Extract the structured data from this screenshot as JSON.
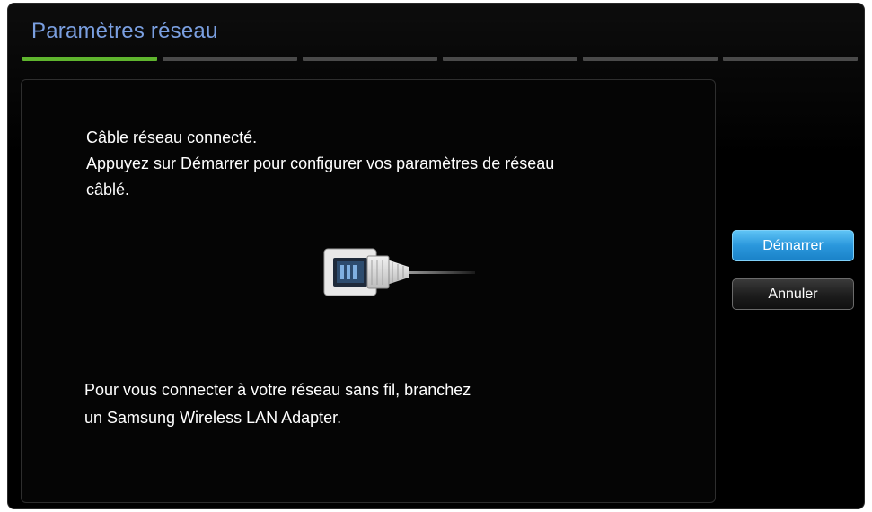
{
  "header": {
    "title": "Paramètres réseau"
  },
  "steps": {
    "total": 6,
    "current": 1,
    "active_color": "#5fb52e",
    "inactive_color": "#4a4a4a"
  },
  "content": {
    "line1": "Câble réseau connecté.",
    "line2": "Appuyez sur Démarrer pour configurer vos paramètres de réseau",
    "line3": "câblé.",
    "wireless_line1": "Pour vous connecter à votre réseau sans fil, branchez",
    "wireless_line2": "un Samsung Wireless LAN Adapter.",
    "illustration": "ethernet-cable-icon"
  },
  "actions": {
    "start_label": "Démarrer",
    "cancel_label": "Annuler"
  },
  "colors": {
    "title": "#7a9fe0",
    "primary_button": "#2a97dc",
    "background": "#000000"
  }
}
